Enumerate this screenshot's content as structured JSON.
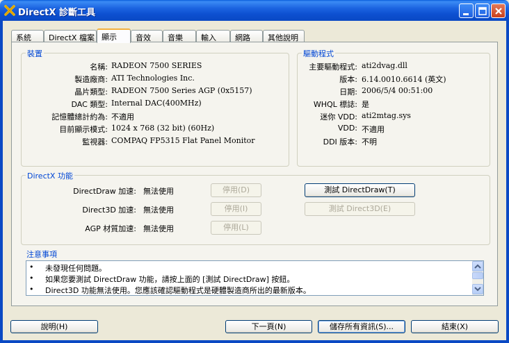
{
  "window": {
    "title": "DirectX 診斷工具"
  },
  "tabs": [
    {
      "label": "系統"
    },
    {
      "label": "DirectX 檔案"
    },
    {
      "label": "顯示"
    },
    {
      "label": "音效"
    },
    {
      "label": "音樂"
    },
    {
      "label": "輸入"
    },
    {
      "label": "網路"
    },
    {
      "label": "其他說明"
    }
  ],
  "device": {
    "title": "裝置",
    "rows": [
      {
        "label": "名稱:",
        "value": "RADEON 7500 SERIES"
      },
      {
        "label": "製造廠商:",
        "value": "ATI Technologies Inc."
      },
      {
        "label": "晶片類型:",
        "value": "RADEON 7500 Series AGP (0x5157)"
      },
      {
        "label": "DAC 類型:",
        "value": "Internal DAC(400MHz)"
      },
      {
        "label": "記憶體總計約為:",
        "value": "不適用"
      },
      {
        "label": "目前顯示模式:",
        "value": "1024 x 768 (32 bit) (60Hz)"
      },
      {
        "label": "監視器:",
        "value": "COMPAQ FP5315 Flat Panel Monitor"
      }
    ]
  },
  "driver": {
    "title": "驅動程式",
    "rows": [
      {
        "label": "主要驅動程式:",
        "value": "ati2dvag.dll"
      },
      {
        "label": "版本:",
        "value": "6.14.0010.6614 (英文)"
      },
      {
        "label": "日期:",
        "value": "2006/5/4 00:51:00"
      },
      {
        "label": "WHQL 標誌:",
        "value": "是"
      },
      {
        "label": "迷你 VDD:",
        "value": "ati2mtag.sys"
      },
      {
        "label": "VDD:",
        "value": "不適用"
      },
      {
        "label": "DDI 版本:",
        "value": "不明"
      }
    ]
  },
  "features": {
    "title": "DirectX 功能",
    "rows": [
      {
        "label": "DirectDraw 加速:",
        "value": "無法使用",
        "disable": "停用(D)",
        "test": "測試 DirectDraw(T)",
        "test_enabled": true
      },
      {
        "label": "Direct3D 加速:",
        "value": "無法使用",
        "disable": "停用(I)",
        "test": "測試 Direct3D(E)",
        "test_enabled": false
      },
      {
        "label": "AGP 材質加速:",
        "value": "無法使用",
        "disable": "停用(L)"
      }
    ]
  },
  "notes": {
    "title": "注意事項",
    "items": [
      "未發現任何問題。",
      "如果您要測試 DirectDraw 功能，請按上面的 [測試 DirectDraw] 按鈕。",
      "Direct3D 功能無法使用。您應該確認驅動程式是硬體製造商所出的最新版本。"
    ]
  },
  "buttons": {
    "help": "說明(H)",
    "next": "下一頁(N)",
    "save": "儲存所有資訊(S)...",
    "exit": "結束(X)"
  },
  "colors": {
    "titlebar": "#0a49c4",
    "group_title": "#0046d5",
    "face": "#ece9d8"
  }
}
